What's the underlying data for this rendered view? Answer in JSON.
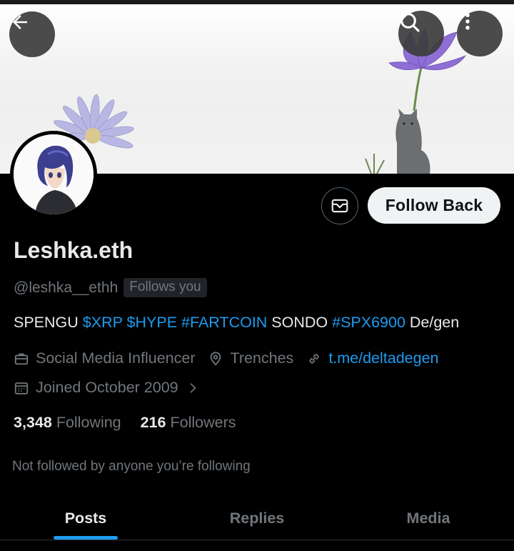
{
  "header": {
    "back_icon": "arrow-left-icon",
    "search_icon": "search-icon",
    "more_icon": "more-vertical-icon"
  },
  "profile": {
    "name": "Leshka.eth",
    "handle": "@leshka__ethh",
    "follows_you": "Follows you",
    "follow_back_label": "Follow Back",
    "message_icon": "envelope-icon",
    "bio": [
      {
        "text": "SPENGU ",
        "tag": false
      },
      {
        "text": "$XRP",
        "tag": true
      },
      {
        "text": " ",
        "tag": false
      },
      {
        "text": "$HYPE",
        "tag": true
      },
      {
        "text": " ",
        "tag": false
      },
      {
        "text": "#FARTCOIN",
        "tag": true
      },
      {
        "text": " SONDO ",
        "tag": false
      },
      {
        "text": "#SPX6900",
        "tag": true
      },
      {
        "text": " De/gen",
        "tag": false
      }
    ],
    "category": "Social Media Influencer",
    "location": "Trenches",
    "website": "t.me/deltadegen",
    "joined": "Joined October 2009",
    "following_count": "3,348",
    "following_label": "Following",
    "followers_count": "216",
    "followers_label": "Followers",
    "not_followed": "Not followed by anyone you’re following"
  },
  "tabs": [
    {
      "label": "Posts",
      "active": true
    },
    {
      "label": "Replies",
      "active": false
    },
    {
      "label": "Media",
      "active": false
    }
  ],
  "colors": {
    "accent": "#1d9bf0",
    "background": "#000000",
    "muted": "#71767b"
  }
}
